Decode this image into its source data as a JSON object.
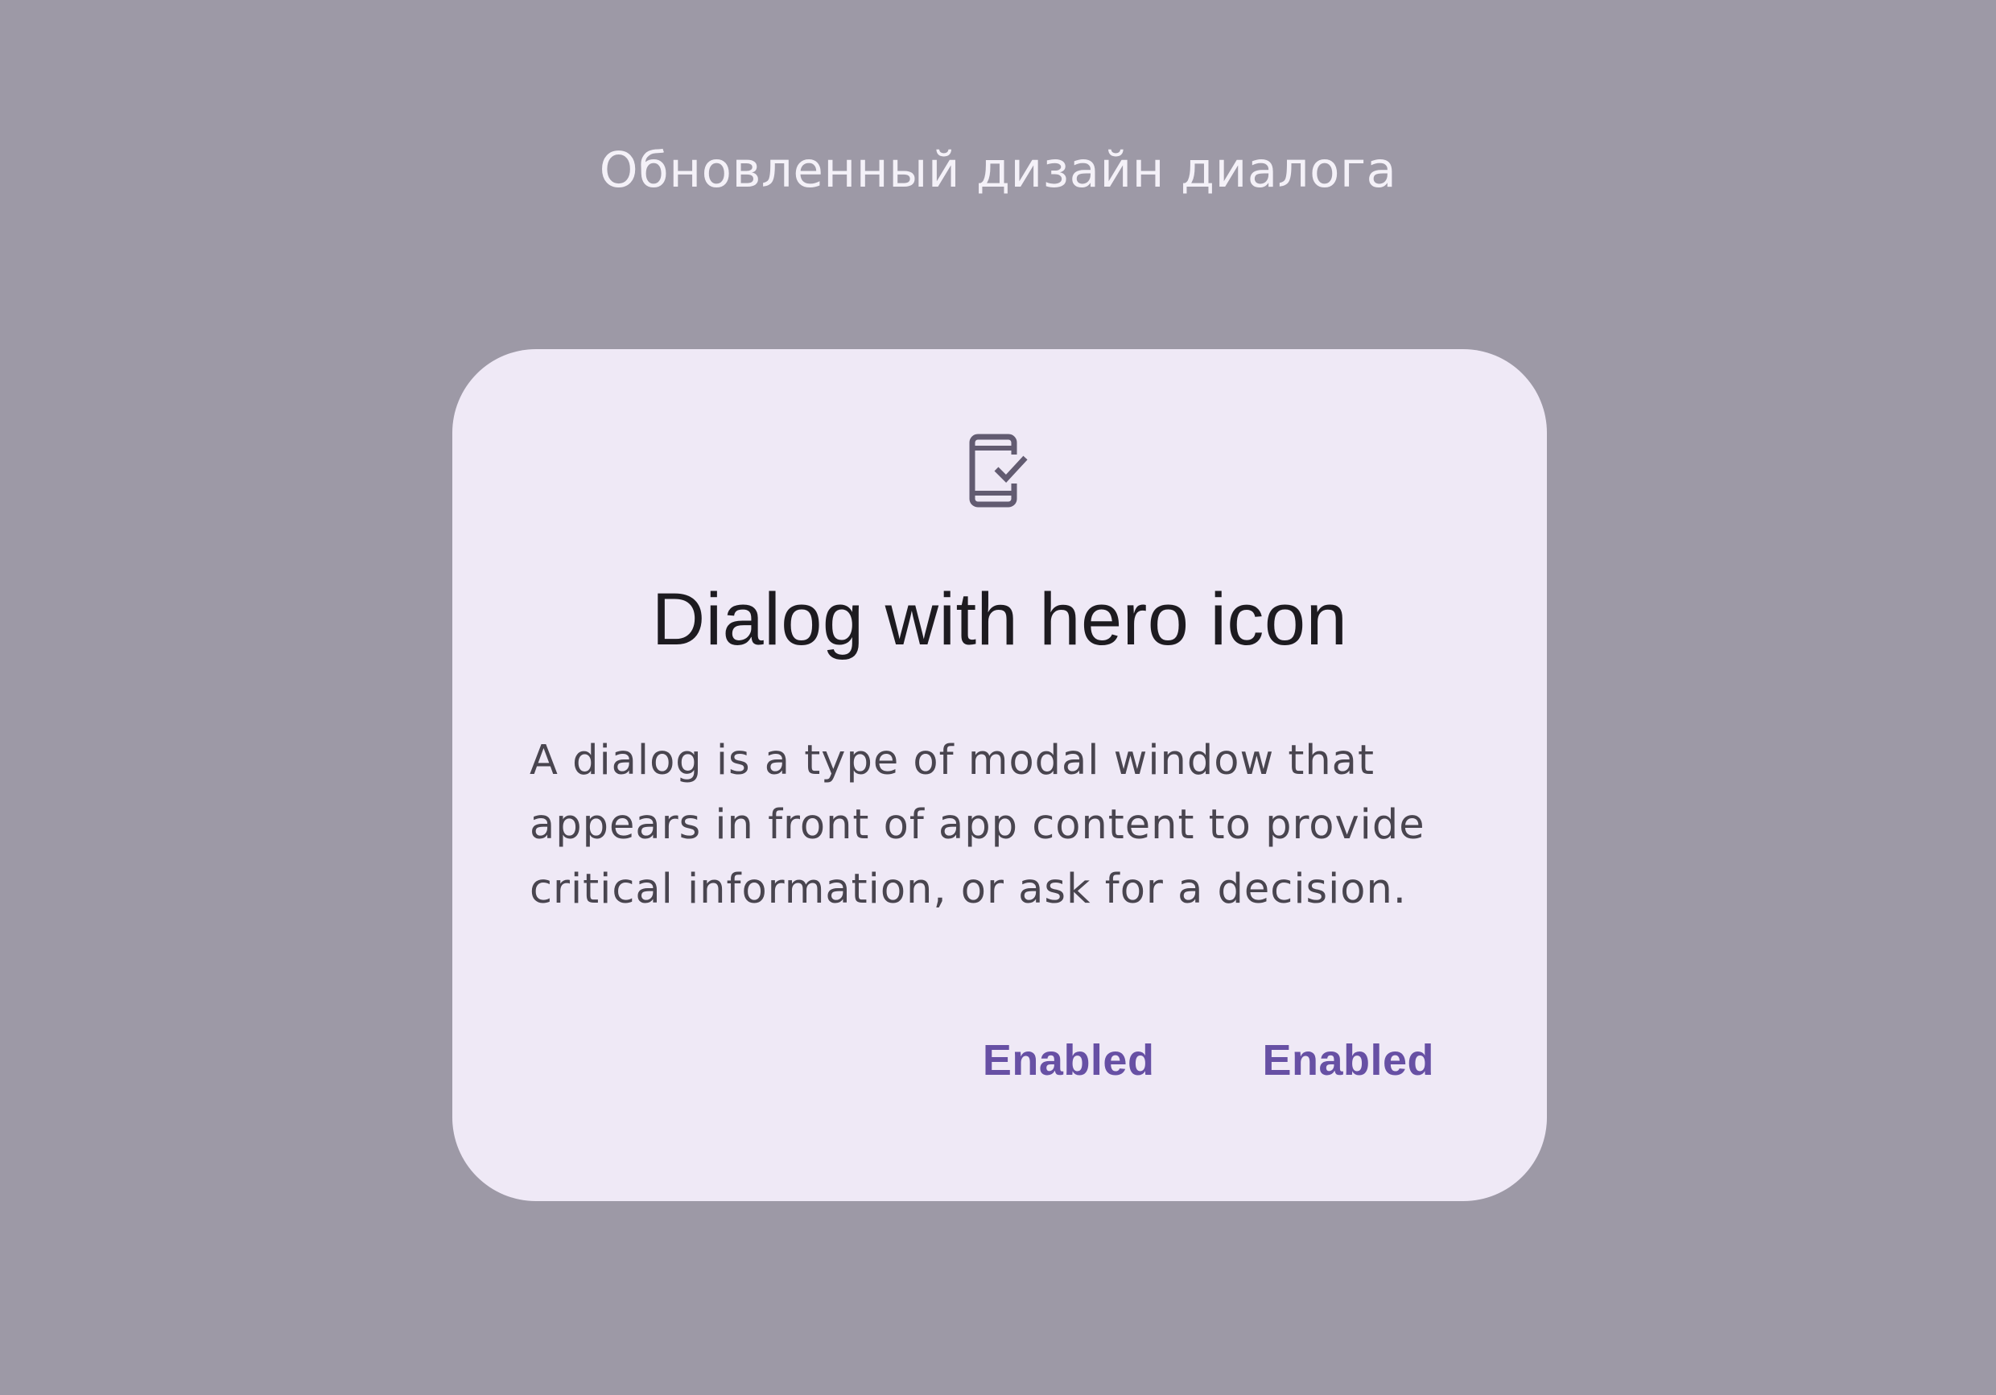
{
  "page": {
    "caption": "Обновленный дизайн диалога"
  },
  "dialog": {
    "icon": "mobile-check-icon",
    "title": "Dialog with hero icon",
    "body": "A dialog is a type of modal window that appears in front of app content to provide critical information, or ask for a decision.",
    "actions": [
      {
        "label": "Enabled"
      },
      {
        "label": "Enabled"
      }
    ]
  },
  "colors": {
    "scrim": "#9d99a6",
    "surface": "#efe9f6",
    "primary": "#6750a4",
    "on_surface": "#1d1b20",
    "on_surface_variant": "#49454f",
    "icon": "#625b71"
  }
}
